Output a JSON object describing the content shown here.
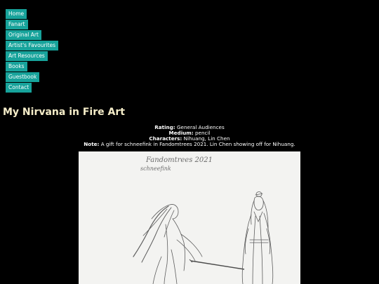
{
  "nav": {
    "items": [
      {
        "label": "Home"
      },
      {
        "label": "Fanart"
      },
      {
        "label": "Original Art"
      },
      {
        "label": "Artist's Favourites"
      },
      {
        "label": "Art Resources"
      },
      {
        "label": "Books"
      },
      {
        "label": "Guestbook"
      },
      {
        "label": "Contact"
      }
    ]
  },
  "page": {
    "title": "My Nirvana in Fire Art"
  },
  "artwork_info": {
    "rating_label": "Rating:",
    "rating_value": "General Audiences",
    "medium_label": "Medium:",
    "medium_value": "pencil",
    "characters_label": "Characters:",
    "characters_value": "Nihuang, Lin Chen",
    "note_label": "Note:",
    "note_value": "A gift for schneefink in Fandomtrees 2021. Lin Chen showing off for Nihuang."
  },
  "artwork": {
    "inscription_line1": "Fandomtrees 2021",
    "inscription_line2": "schneefink"
  },
  "colors": {
    "background": "#000000",
    "nav_button": "#17a39b",
    "title": "#f5edc9"
  }
}
